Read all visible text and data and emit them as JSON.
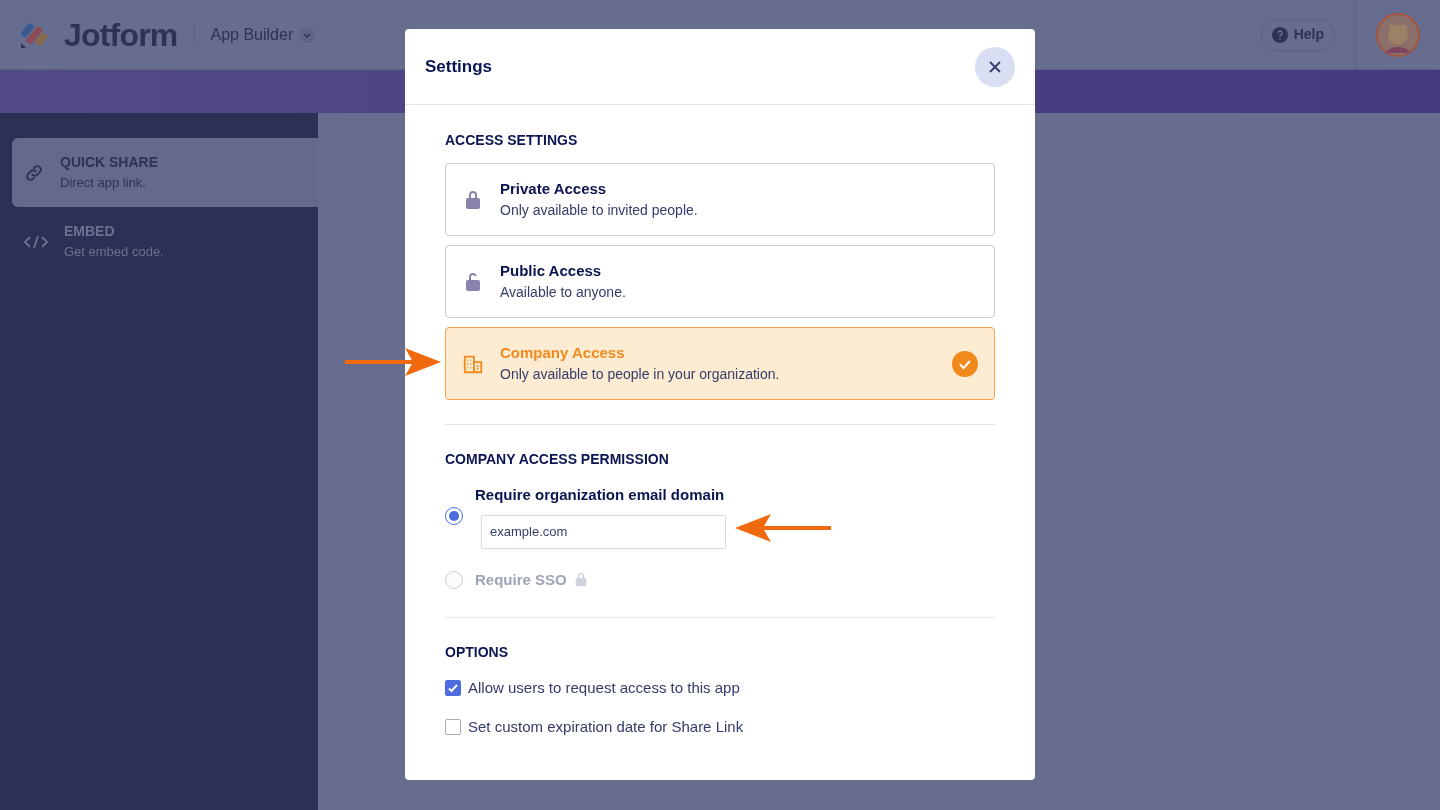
{
  "header": {
    "logo": "Jotform",
    "product": "App Builder",
    "help": "Help"
  },
  "sidebar": {
    "items": [
      {
        "kind": "link",
        "title": "QUICK SHARE",
        "subtitle": "Direct app link.",
        "selected": true
      },
      {
        "kind": "code",
        "title": "EMBED",
        "subtitle": "Get embed code.",
        "selected": false
      }
    ]
  },
  "dialog": {
    "title": "Settings",
    "access_heading": "ACCESS SETTINGS",
    "access_options": [
      {
        "kind": "private",
        "title": "Private Access",
        "description": "Only available to invited people.",
        "selected": false
      },
      {
        "kind": "public",
        "title": "Public Access",
        "description": "Available to anyone.",
        "selected": false
      },
      {
        "kind": "company",
        "title": "Company Access",
        "description": "Only available to people in your organization.",
        "selected": true
      }
    ],
    "permission_heading": "COMPANY ACCESS PERMISSION",
    "permissions": [
      {
        "label": "Require organization email domain",
        "selected": true,
        "disabled": false,
        "domain": "example.com"
      },
      {
        "label": "Require SSO",
        "selected": false,
        "disabled": true
      }
    ],
    "options_heading": "OPTIONS",
    "options": [
      {
        "label": "Allow users to request access to this app",
        "checked": true
      },
      {
        "label": "Set custom expiration date for Share Link",
        "checked": false
      }
    ]
  }
}
